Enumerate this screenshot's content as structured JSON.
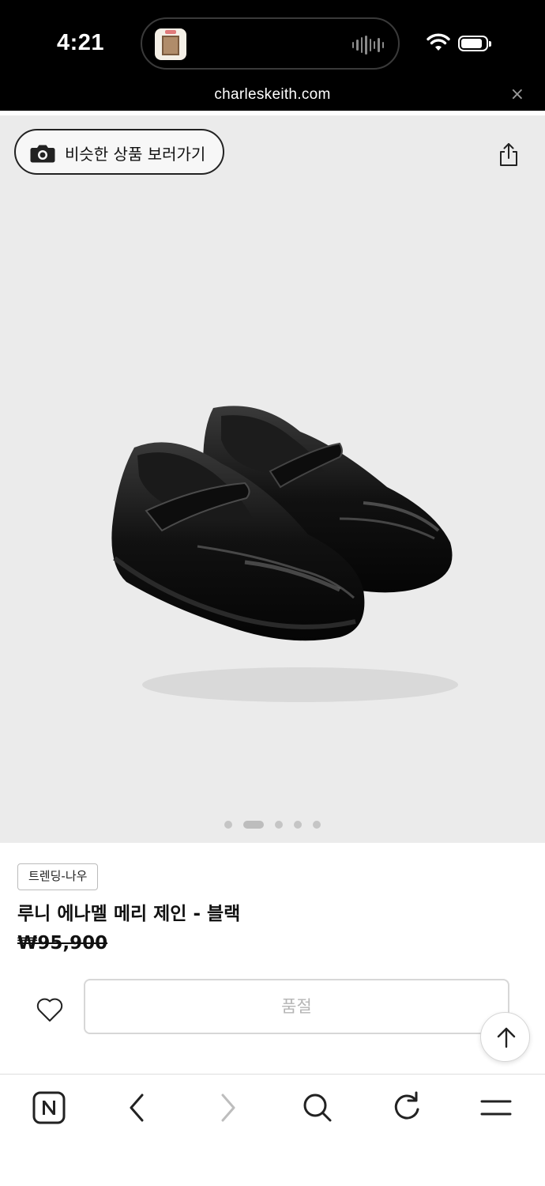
{
  "status_bar": {
    "time": "4:21",
    "icons": [
      "now-playing-thumbnail",
      "audio-waveform-icon",
      "wifi-icon",
      "battery-icon"
    ]
  },
  "browser": {
    "url": "charleskeith.com",
    "close_icon": "×"
  },
  "hero": {
    "similar_button_label": "비슷한 상품 보러가기",
    "background_color": "#ebebeb",
    "carousel": {
      "total": 5,
      "active_index": 1
    }
  },
  "product": {
    "tag": "트렌딩-나우",
    "title": "루니 에나멜 메리 제인 - 블랙",
    "price": "₩95,900",
    "soldout_label": "품절"
  },
  "toolbar": {
    "items": [
      "naver-home-icon",
      "back-arrow-icon",
      "forward-arrow-icon",
      "search-icon",
      "refresh-icon",
      "menu-icon"
    ]
  },
  "colors": {
    "status_bar": "#000000",
    "text": "#111111",
    "disabled_text": "#b5b5b5"
  }
}
